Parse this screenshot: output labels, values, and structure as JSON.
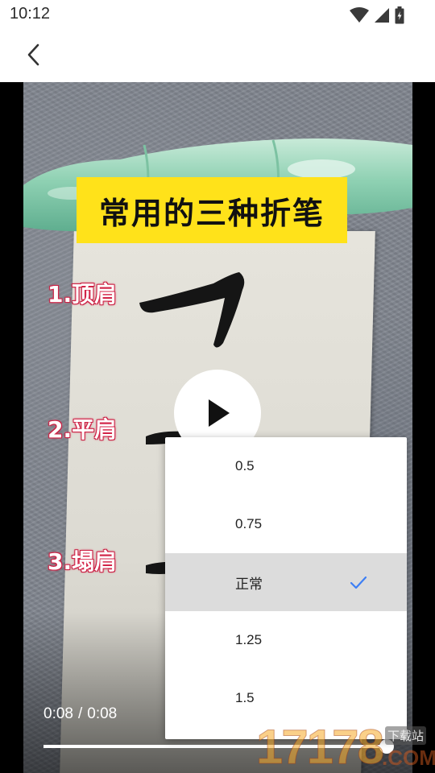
{
  "status_bar": {
    "time": "10:12",
    "icons": [
      "wifi-icon",
      "cell-signal-icon",
      "battery-charging-icon"
    ]
  },
  "app_bar": {
    "back_icon": "chevron-left-icon"
  },
  "video": {
    "title_banner": "常用的三种折笔",
    "stroke_labels": [
      "1.顶肩",
      "2.平肩",
      "3.塌肩"
    ],
    "current_time": "0:08",
    "duration": "0:08",
    "time_separator": "/",
    "progress": 1.0,
    "state": "paused"
  },
  "speed_menu": {
    "options": [
      {
        "label": "0.5",
        "selected": false
      },
      {
        "label": "0.75",
        "selected": false
      },
      {
        "label": "正常",
        "selected": true
      },
      {
        "label": "1.25",
        "selected": false
      },
      {
        "label": "1.5",
        "selected": false
      }
    ]
  },
  "watermark": {
    "digits": "17178",
    "site_label": "下载站",
    "suffix": ".COM"
  },
  "colors": {
    "accent": "#3d7ff5",
    "banner": "#ffe21a",
    "label_outline": "#d8264a"
  }
}
